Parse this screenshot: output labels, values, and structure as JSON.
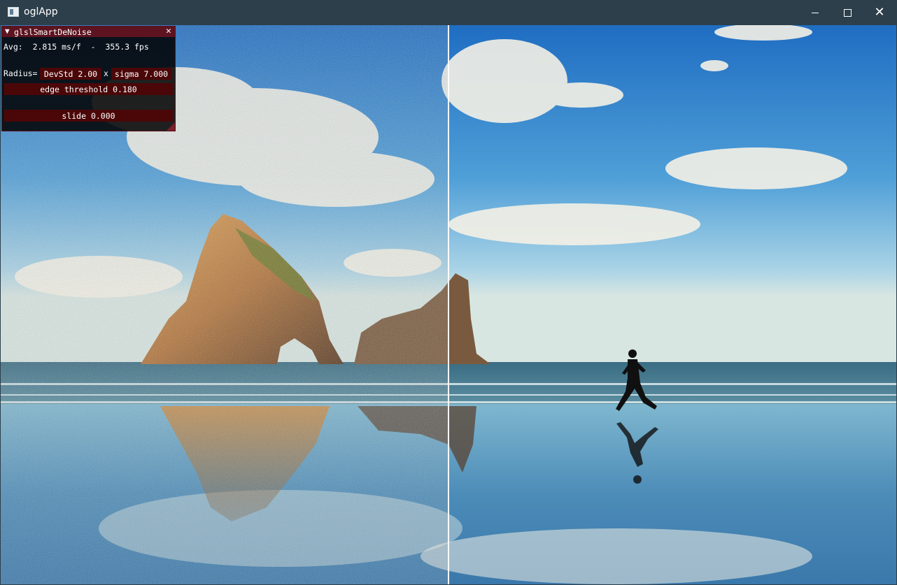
{
  "window": {
    "title": "oglApp",
    "minimize_icon": "minimize-icon",
    "maximize_icon": "maximize-icon",
    "close_icon": "close-icon",
    "close_glyph": "✕"
  },
  "panel": {
    "collapse_glyph": "▼",
    "title": "glslSmartDeNoise",
    "close_glyph": "✕",
    "avg_label": "Avg:",
    "avg_ms": "2.815 ms/f",
    "separator": "-",
    "fps": "355.3 fps",
    "radius_label": "Radius=",
    "devstd_label": "DevStd 2.00",
    "x_label": "x",
    "sigma_label": "sigma 7.000",
    "edge_threshold_label": "edge threshold 0.180",
    "slide_label": "slide 0.000"
  },
  "colors": {
    "titlebar": "#2c3f4b",
    "panel_header": "#5d1420",
    "widget_bg": "#4b0708"
  }
}
